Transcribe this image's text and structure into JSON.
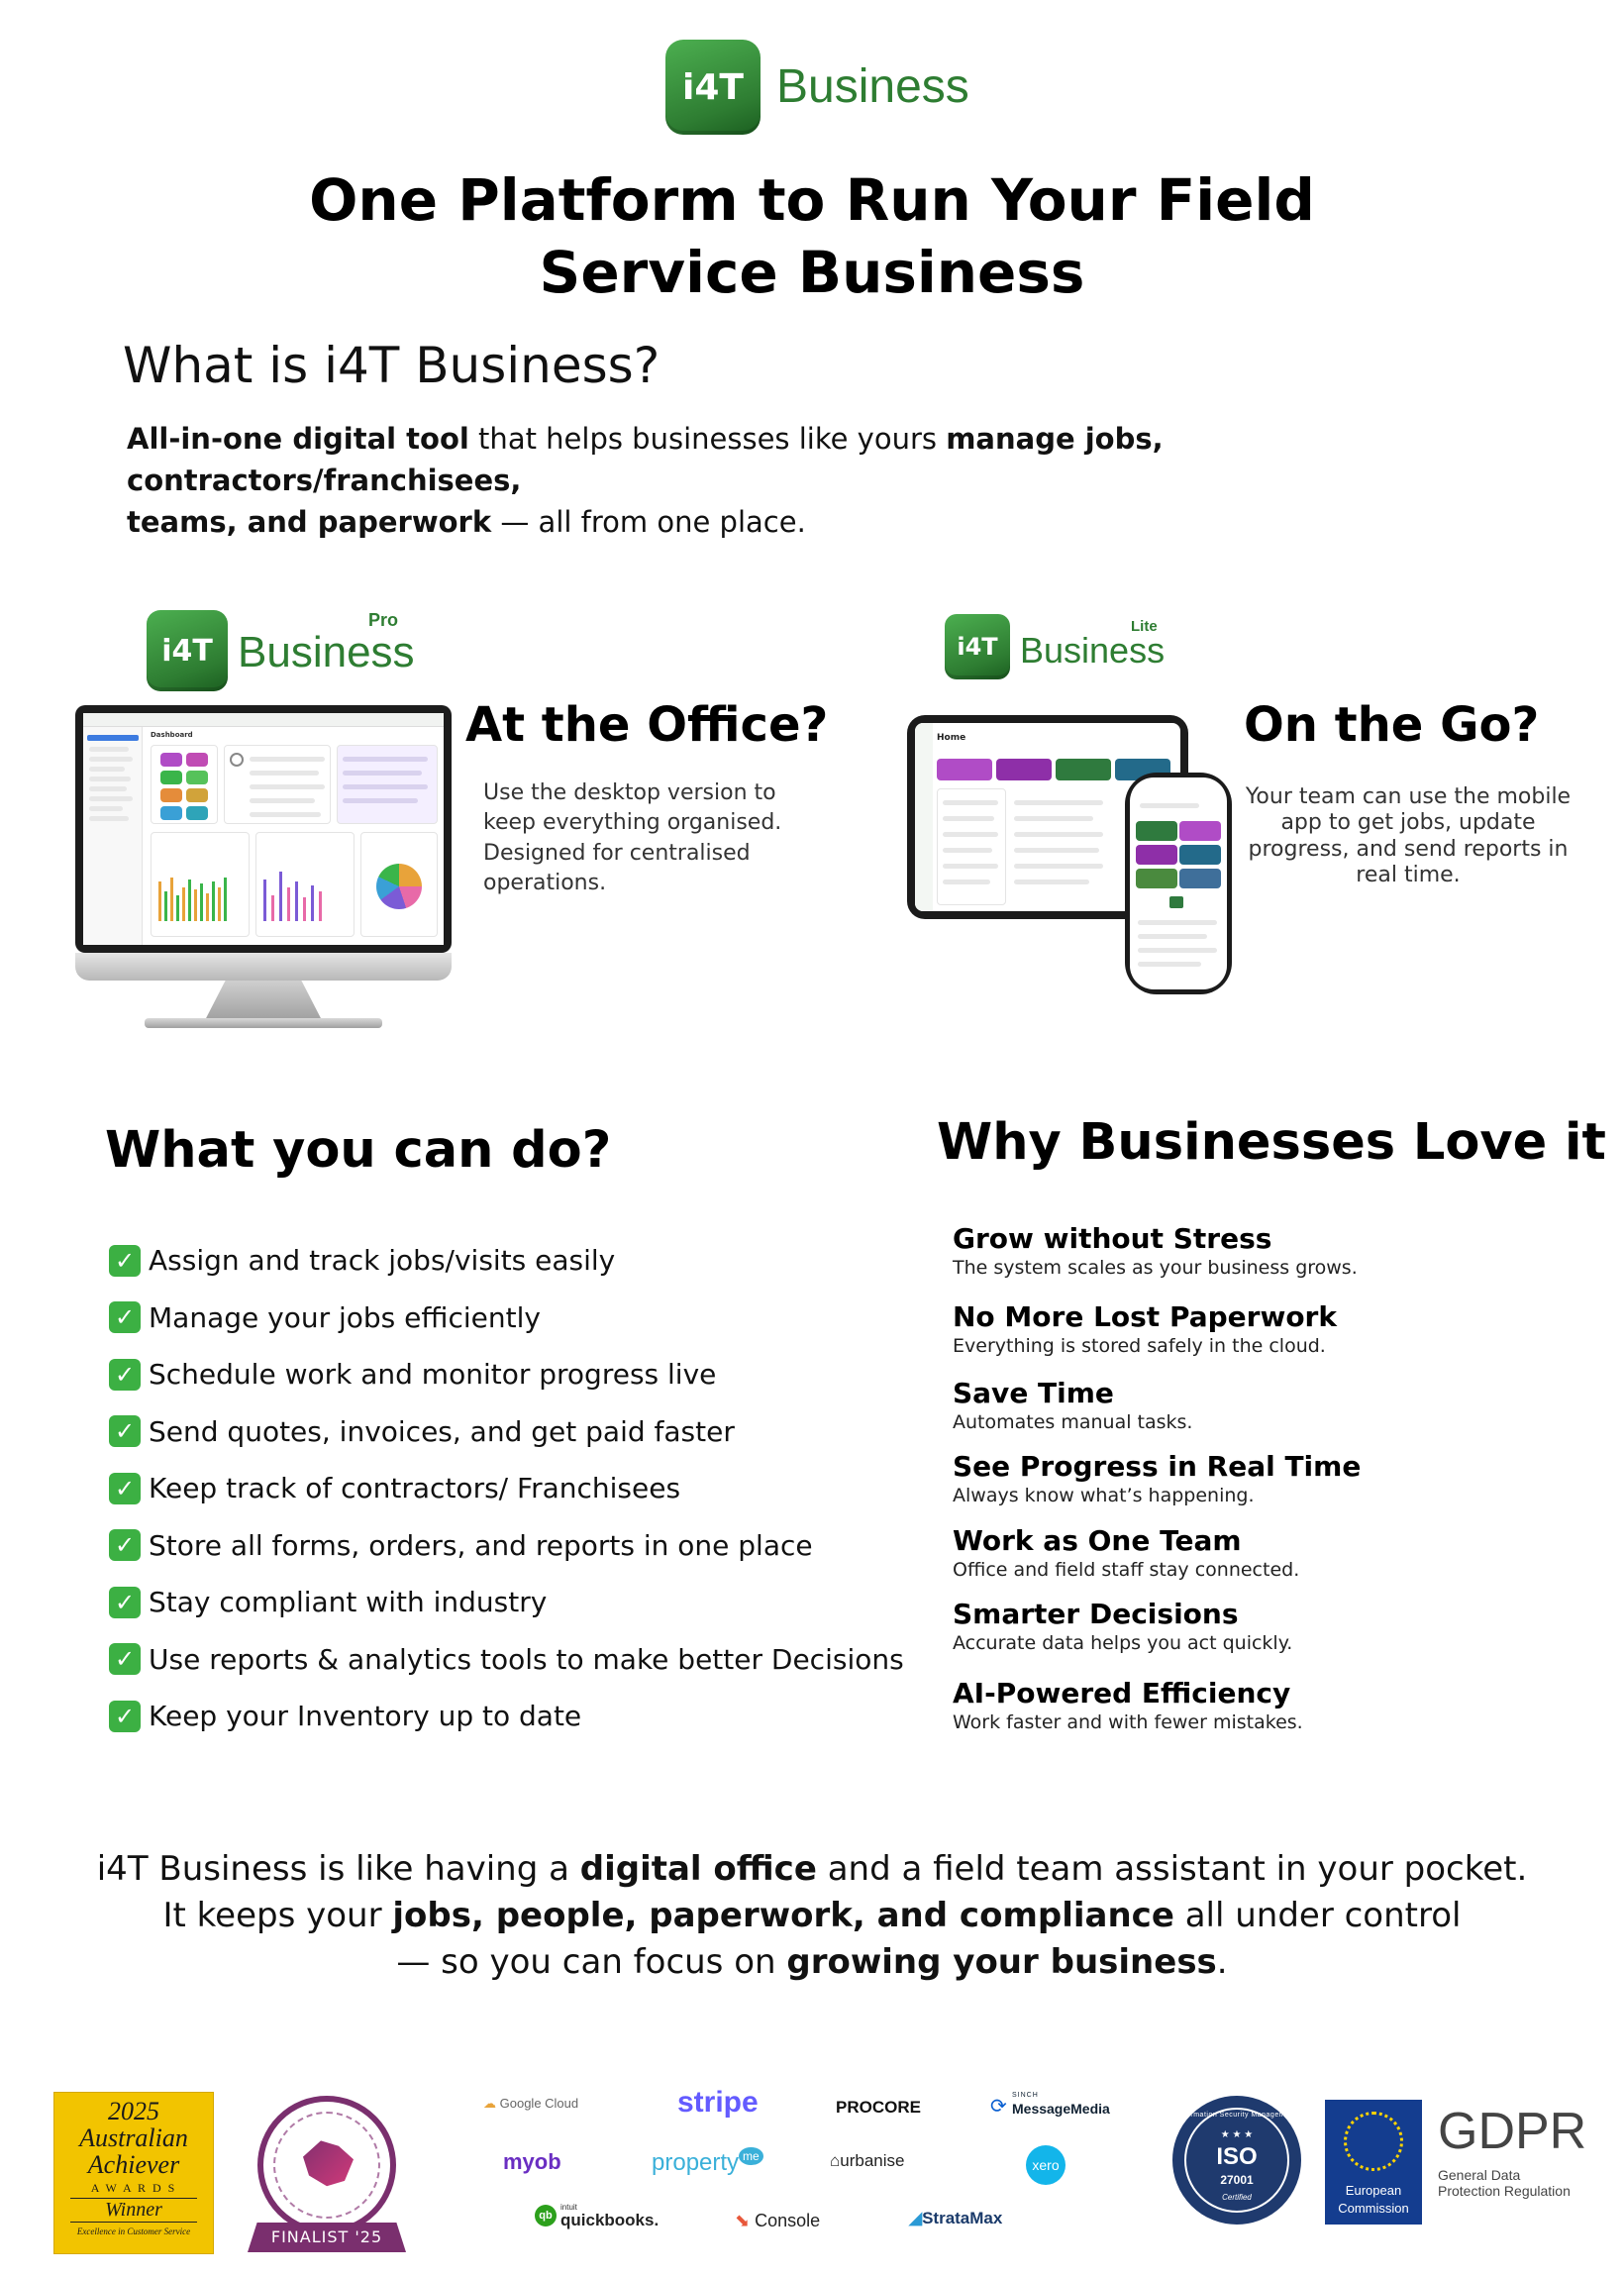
{
  "brand": {
    "icon_text": "i4T",
    "word": "Business"
  },
  "headline": {
    "line1": "One Platform to Run Your Field",
    "line2": "Service Business"
  },
  "what_is": {
    "title": "What is i4T Business?",
    "p1_bold1": "All-in-one digital tool",
    "p1_text1": " that helps businesses like yours ",
    "p1_bold2": "manage jobs, contractors/franchisees,",
    "p2_bold": "teams, and paperwork",
    "p2_text": " — all from one place."
  },
  "office": {
    "logo_sup": "Pro",
    "title": "At the Office?",
    "desc": "Use the desktop version to keep everything organised. Designed for centralised operations.",
    "screen_heading": "Dashboard"
  },
  "go": {
    "logo_sup": "Lite",
    "title": "On the Go?",
    "desc": "Your team can use the mobile app to get jobs, update progress, and send reports in real time.",
    "tablet_heading": "Home"
  },
  "can_do": {
    "title": "What you can do?",
    "items": [
      "Assign and track jobs/visits easily",
      "Manage your jobs efficiently",
      "Schedule work and monitor progress live",
      "Send quotes, invoices, and get paid faster",
      "Keep track of contractors/ Franchisees",
      "Store all forms, orders, and reports in one place",
      "Stay compliant with industry",
      "Use reports & analytics tools to make better Decisions",
      "Keep your Inventory up to date"
    ]
  },
  "why": {
    "title": "Why Businesses Love it",
    "items": [
      {
        "title": "Grow without Stress",
        "desc": "The system scales as your business grows."
      },
      {
        "title": "No More Lost Paperwork",
        "desc": "Everything is stored safely in the cloud."
      },
      {
        "title": "Save Time",
        "desc": "Automates manual tasks."
      },
      {
        "title": "See Progress in Real Time",
        "desc": "Always know what’s happening."
      },
      {
        "title": "Work as One Team",
        "desc": "Office and field staff stay connected."
      },
      {
        "title": "Smarter Decisions",
        "desc": "Accurate data helps you act quickly."
      },
      {
        "title": "AI-Powered Efficiency",
        "desc": "Work faster and with fewer mistakes."
      }
    ]
  },
  "closing": {
    "l1_a": "i4T Business is like having a ",
    "l1_b": "digital office",
    "l1_c": " and a field team assistant in your pocket.",
    "l2_a": "It keeps your ",
    "l2_b": "jobs, people, paperwork, and compliance",
    "l2_c": " all under control",
    "l3_a": "— so you can focus on ",
    "l3_b": "growing your business",
    "l3_c": "."
  },
  "awards": {
    "aa_year": "2025",
    "aa_name1": "Australian",
    "aa_name2": "Achiever",
    "aa_awards": "A W A R D S",
    "aa_winner": "Winner",
    "aa_caption": "Excellence in Customer Service",
    "finalist": "FINALIST '25"
  },
  "partners": {
    "google_cloud": "Google Cloud",
    "stripe": "stripe",
    "procore": "PROCORE",
    "sinch": "SINCH",
    "messagemedia": "MessageMedia",
    "myob": "myob",
    "propertyme": "property",
    "propertyme_me": "me",
    "urbanise": "urbanise",
    "xero": "xero",
    "intuit": "intuit",
    "quickbooks": "quickbooks.",
    "console": "Console",
    "stratamax": "StrataMax"
  },
  "certs": {
    "iso_ring": "Information Security Management",
    "iso": "ISO",
    "iso_num": "27001",
    "iso_cert": "Certified",
    "eu1": "European",
    "eu2": "Commission",
    "gdpr": "GDPR",
    "gdpr_sub1": "General Data",
    "gdpr_sub2": "Protection Regulation"
  },
  "colors": {
    "brand_green": "#2e7d32",
    "check_green": "#3cb043"
  }
}
